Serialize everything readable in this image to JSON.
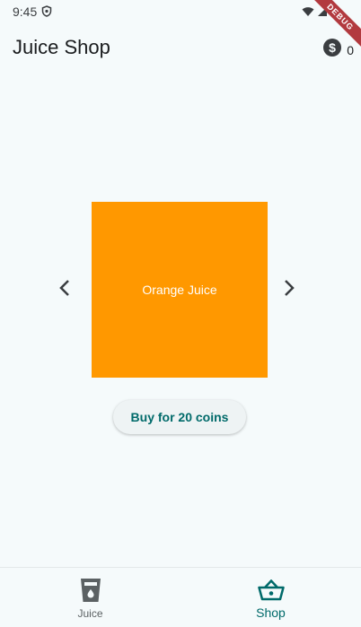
{
  "status_bar": {
    "time": "9:45",
    "debug_label": "DEBUG"
  },
  "app_bar": {
    "title": "Juice Shop",
    "coin_count": "0"
  },
  "carousel": {
    "current_item": "Orange Juice",
    "card_color": "#ff9800"
  },
  "buy_button": {
    "label": "Buy for 20 coins"
  },
  "bottom_nav": {
    "items": [
      {
        "label": "Juice",
        "icon": "cup-icon",
        "selected": false
      },
      {
        "label": "Shop",
        "icon": "basket-icon",
        "selected": true
      }
    ],
    "active_color": "#006a6a"
  }
}
